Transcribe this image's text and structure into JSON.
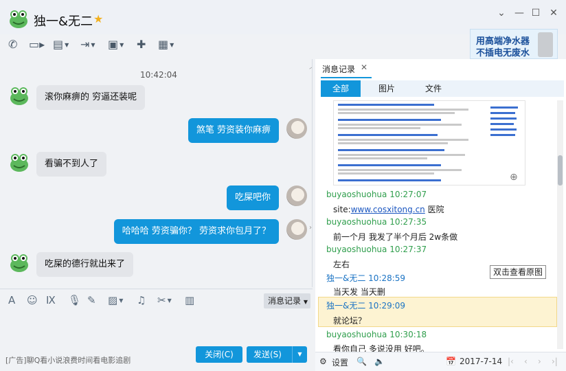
{
  "title": "独一&无二",
  "toolbar": {
    "icons": [
      "phone-icon",
      "video-icon",
      "screen-share-icon",
      "file-transfer-icon",
      "remote-desktop-icon",
      "chat-add-icon",
      "apps-icon"
    ]
  },
  "ad_banner": {
    "line1": "用高端净水器",
    "line2": "不插电无废水"
  },
  "chat": {
    "time": "10:42:04",
    "messages": [
      {
        "side": "left",
        "text": "滚你麻痹的   穷逼还装呢"
      },
      {
        "side": "right",
        "text": "煞笔 劳资装你麻痹"
      },
      {
        "side": "left",
        "text": "看骗不到人了"
      },
      {
        "side": "right",
        "text": "吃屎吧你"
      },
      {
        "side": "right",
        "text": "哈哈哈 劳资骗你？ 劳资求你包月了？"
      },
      {
        "side": "left",
        "text": "吃屎的德行就出来了"
      }
    ]
  },
  "input_toolbar": {
    "history_label": "消息记录"
  },
  "footer_left": {
    "ad_text": "[广告]聊Q看小说浪费时间看电影追剧",
    "close_label": "关闭(C)",
    "send_label": "发送(S)"
  },
  "history": {
    "tab_label": "消息记录",
    "filters": [
      "全部",
      "图片",
      "文件"
    ],
    "view_original": "双击查看原图",
    "entries": [
      {
        "sender": "buyaoshuohua 10:27:07",
        "text_prefix": "site:",
        "link": "www.cosxitong.cn",
        "text_suffix": " 医院",
        "me": false
      },
      {
        "sender": "buyaoshuohua 10:27:35",
        "text": "前一个月 我发了半个月后 2w条做",
        "me": false
      },
      {
        "sender": "buyaoshuohua 10:27:37",
        "text": "左右",
        "me": false
      },
      {
        "sender": "独一&无二 10:28:59",
        "text": "当天发  当天删",
        "me": true
      },
      {
        "sender": "独一&无二 10:29:09",
        "text": "就论坛？",
        "me": true
      },
      {
        "sender": "buyaoshuohua 10:30:18",
        "text": "看你自己 多说没用 好吧。",
        "me": false
      }
    ],
    "footer": {
      "settings_label": "设置",
      "date": "2017-7-14"
    }
  }
}
